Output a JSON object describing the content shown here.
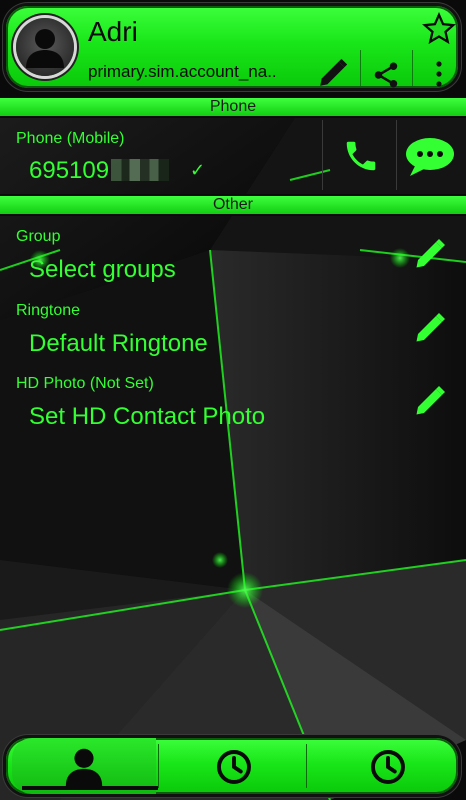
{
  "header": {
    "name": "Adri",
    "account": "primary.sim.account_na..",
    "icons": [
      "avatar-icon",
      "pencil-icon",
      "share-icon",
      "overflow-icon",
      "star-icon"
    ]
  },
  "sections": {
    "phone": "Phone",
    "other": "Other"
  },
  "phone": {
    "label": "Phone  (Mobile)",
    "number_visible": "695109",
    "check": "✓",
    "icons": [
      "call-icon",
      "message-icon"
    ]
  },
  "fields": [
    {
      "label": "Group",
      "value": "Select groups"
    },
    {
      "label": "Ringtone",
      "value": "Default Ringtone"
    },
    {
      "label": "HD Photo (Not Set)",
      "value": "Set HD Contact Photo"
    }
  ],
  "bottom_tabs": [
    "contact-tab",
    "history-tab",
    "recent-tab"
  ],
  "colors": {
    "accent": "#33ff33",
    "bar": "#19e619",
    "background": "#0b0b0b"
  }
}
